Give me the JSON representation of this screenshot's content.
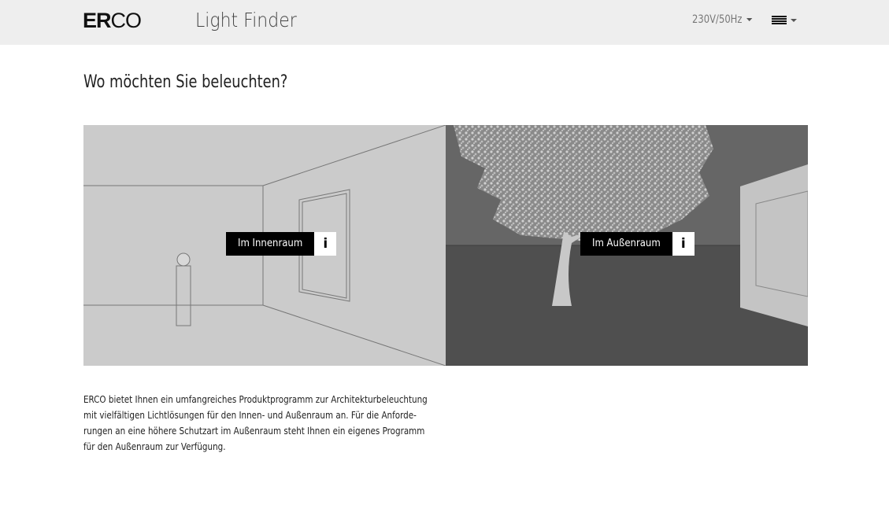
{
  "header": {
    "logo": {
      "bold": "ER",
      "light": "CO"
    },
    "title": "Light Finder",
    "voltage_selector": "230V/50Hz",
    "menu_icon": "hamburger-icon"
  },
  "main": {
    "heading": "Wo möchten Sie beleuchten?",
    "options": [
      {
        "label": "Im Innenraum",
        "info": "i"
      },
      {
        "label": "Im Außenraum",
        "info": "i"
      }
    ],
    "description": [
      "ERCO bietet Ihnen ein umfangreiches Produktprogramm zur Architekturbeleuchtung",
      "mit vielfältigen Lichtlösungen für den Innen- und Außenraum an. Für die Anforde-",
      "rungen an eine höhere Schutzart im Außenraum steht Ihnen ein eigenes Programm",
      "für den Außenraum zur Verfügung."
    ]
  }
}
